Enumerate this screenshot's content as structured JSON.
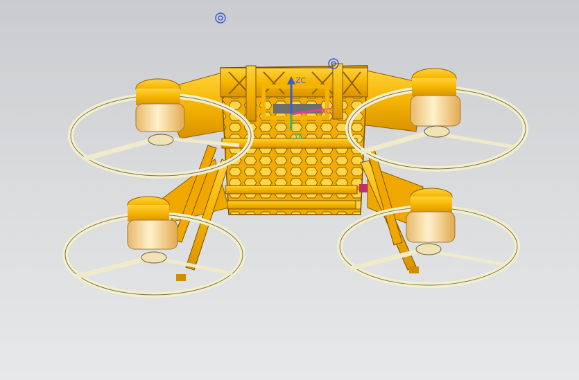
{
  "viewport": {
    "background_top": "#c9cbce",
    "background_bottom": "#e7e8e9"
  },
  "model": {
    "body_color": "#f5b400",
    "body_dark": "#c98a00",
    "ring_color": "#eeeac4",
    "motor_light": "#ffe6a8"
  },
  "triad": {
    "x_label": "XC",
    "y_label": "YC",
    "z_label": "ZC",
    "x_color": "#e0409a",
    "y_color": "#2bb673",
    "z_color": "#3a5fcd"
  },
  "markers": {
    "datum_icon": "datum-point-icon",
    "anchor_icon": "anchor-point-icon"
  }
}
